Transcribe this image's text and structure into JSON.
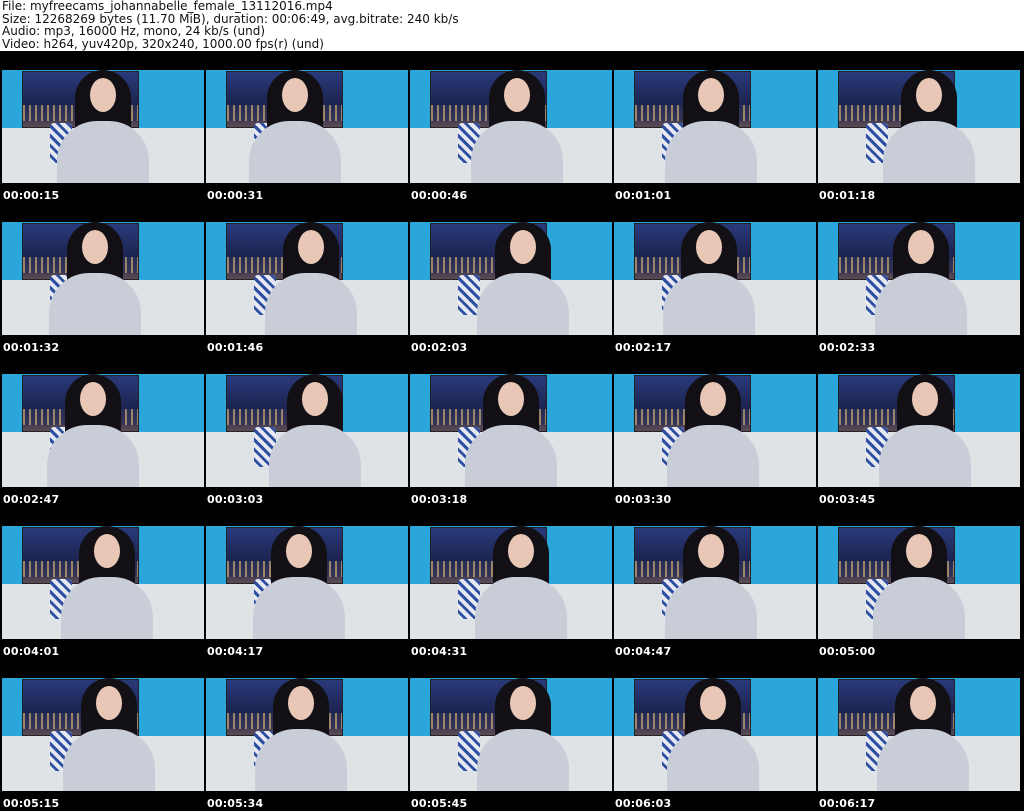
{
  "header": {
    "file": "File: myfreecams_johannabelle_female_13112016.mp4",
    "size": "Size: 12268269 bytes (11.70 MiB), duration: 00:06:49, avg.bitrate: 240 kb/s",
    "audio": "Audio: mp3, 16000 Hz, mono, 24 kb/s (und)",
    "video": "Video: h264, yuv420p, 320x240, 1000.00 fps(r) (und)"
  },
  "thumbnails": [
    {
      "time": "00:00:15"
    },
    {
      "time": "00:00:31"
    },
    {
      "time": "00:00:46"
    },
    {
      "time": "00:01:01"
    },
    {
      "time": "00:01:18"
    },
    {
      "time": "00:01:32"
    },
    {
      "time": "00:01:46"
    },
    {
      "time": "00:02:03"
    },
    {
      "time": "00:02:17"
    },
    {
      "time": "00:02:33"
    },
    {
      "time": "00:02:47"
    },
    {
      "time": "00:03:03"
    },
    {
      "time": "00:03:18"
    },
    {
      "time": "00:03:30"
    },
    {
      "time": "00:03:45"
    },
    {
      "time": "00:04:01"
    },
    {
      "time": "00:04:17"
    },
    {
      "time": "00:04:31"
    },
    {
      "time": "00:04:47"
    },
    {
      "time": "00:05:00"
    },
    {
      "time": "00:05:15"
    },
    {
      "time": "00:05:34"
    },
    {
      "time": "00:05:45"
    },
    {
      "time": "00:06:03"
    },
    {
      "time": "00:06:17"
    }
  ]
}
